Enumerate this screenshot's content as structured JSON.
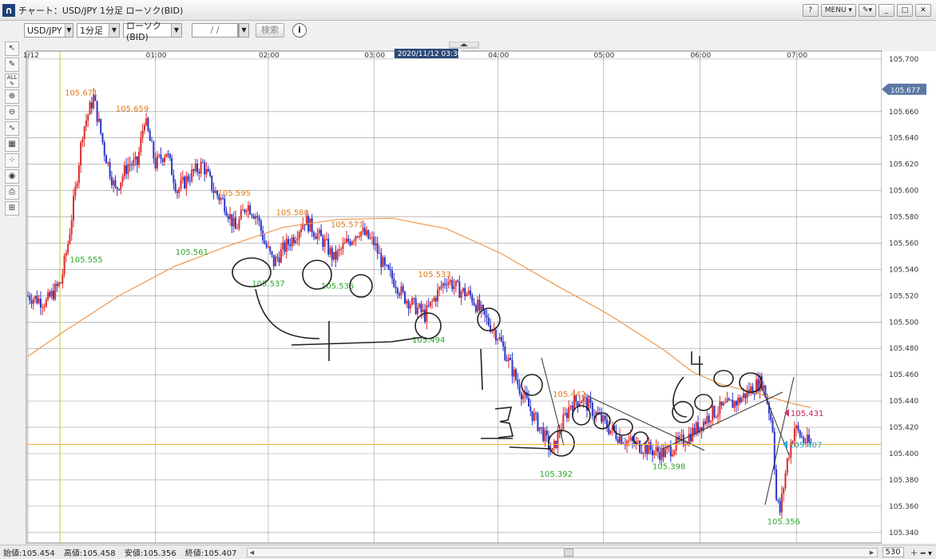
{
  "window": {
    "title": "チャート：USD/JPY 1分足 ローソク(BID)",
    "buttons": [
      "?",
      "MENU ▾",
      "✎▾",
      "_",
      "□",
      "✕"
    ]
  },
  "toolbar": {
    "pair": "USD/JPY",
    "timeframe": "1分足",
    "chart_type": "ローソク(BID)",
    "date_placeholder": "/ /",
    "search_label": "検索",
    "info_label": "i"
  },
  "tools": [
    "cursor-tool",
    "pen-tool",
    "all-tool",
    "zoom-in-tool",
    "zoom-out-tool",
    "indicator-tool",
    "table-tool",
    "dots-tool",
    "view-tool",
    "print-tool",
    "grid-tool"
  ],
  "statusbar": {
    "open": "始値:105.454",
    "high": "高値:105.458",
    "low": "安値:105.356",
    "close": "終値:105.407",
    "bar_count": "530"
  },
  "colors": {
    "up": "#dd2a2a",
    "down": "#2b34c9",
    "ma": "#f0964a",
    "current_line": "#f3b23f",
    "high_label": "#e07a1a",
    "low_label": "#2aa52a",
    "price_box": "#5a78a3"
  },
  "chart_data": {
    "type": "candlestick",
    "symbol": "USD/JPY",
    "time_labels": [
      "11/12",
      "01:00",
      "02:00",
      "03:00",
      "04:00",
      "05:00",
      "06:00",
      "07:00"
    ],
    "cursor_label": "2020/11/12 03:30",
    "y_ticks": [
      "105.700",
      "105.660",
      "105.640",
      "105.620",
      "105.600",
      "105.580",
      "105.560",
      "105.540",
      "105.520",
      "105.500",
      "105.480",
      "105.460",
      "105.440",
      "105.420",
      "105.400",
      "105.380",
      "105.360",
      "105.340"
    ],
    "ylim": [
      105.332,
      105.706
    ],
    "price_path": [
      [
        0,
        105.52
      ],
      [
        10,
        105.515
      ],
      [
        18,
        105.53
      ],
      [
        22,
        105.56
      ],
      [
        26,
        105.6
      ],
      [
        30,
        105.645
      ],
      [
        36,
        105.671
      ],
      [
        42,
        105.63
      ],
      [
        48,
        105.6
      ],
      [
        55,
        105.62
      ],
      [
        60,
        105.62
      ],
      [
        64,
        105.655
      ],
      [
        70,
        105.62
      ],
      [
        76,
        105.63
      ],
      [
        82,
        105.6
      ],
      [
        88,
        105.61
      ],
      [
        96,
        105.62
      ],
      [
        102,
        105.6
      ],
      [
        108,
        105.59
      ],
      [
        114,
        105.57
      ],
      [
        120,
        105.59
      ],
      [
        126,
        105.58
      ],
      [
        130,
        105.56
      ],
      [
        135,
        105.545
      ],
      [
        140,
        105.555
      ],
      [
        146,
        105.565
      ],
      [
        152,
        105.578
      ],
      [
        158,
        105.568
      ],
      [
        163,
        105.56
      ],
      [
        168,
        105.548
      ],
      [
        175,
        105.56
      ],
      [
        182,
        105.57
      ],
      [
        190,
        105.56
      ],
      [
        196,
        105.54
      ],
      [
        202,
        105.53
      ],
      [
        206,
        105.52
      ],
      [
        210,
        105.515
      ],
      [
        214,
        105.51
      ],
      [
        218,
        105.505
      ],
      [
        224,
        105.52
      ],
      [
        230,
        105.533
      ],
      [
        236,
        105.525
      ],
      [
        243,
        105.52
      ],
      [
        250,
        105.505
      ],
      [
        258,
        105.49
      ],
      [
        264,
        105.47
      ],
      [
        270,
        105.45
      ],
      [
        277,
        105.43
      ],
      [
        283,
        105.415
      ],
      [
        288,
        105.4
      ],
      [
        292,
        105.418
      ],
      [
        298,
        105.438
      ],
      [
        304,
        105.442
      ],
      [
        312,
        105.43
      ],
      [
        320,
        105.418
      ],
      [
        328,
        105.41
      ],
      [
        336,
        105.406
      ],
      [
        344,
        105.402
      ],
      [
        350,
        105.4
      ],
      [
        354,
        105.405
      ],
      [
        360,
        105.41
      ],
      [
        368,
        105.42
      ],
      [
        375,
        105.43
      ],
      [
        382,
        105.435
      ],
      [
        390,
        105.44
      ],
      [
        398,
        105.45
      ],
      [
        403,
        105.455
      ],
      [
        406,
        105.44
      ],
      [
        409,
        105.42
      ],
      [
        411,
        105.365
      ],
      [
        413,
        105.356
      ],
      [
        417,
        105.395
      ],
      [
        421,
        105.42
      ],
      [
        426,
        105.41
      ],
      [
        430,
        105.407
      ]
    ],
    "moving_average": [
      [
        0,
        105.474
      ],
      [
        20,
        105.493
      ],
      [
        50,
        105.52
      ],
      [
        80,
        105.542
      ],
      [
        110,
        105.558
      ],
      [
        140,
        105.572
      ],
      [
        170,
        105.578
      ],
      [
        200,
        105.579
      ],
      [
        230,
        105.571
      ],
      [
        260,
        105.552
      ],
      [
        290,
        105.528
      ],
      [
        320,
        105.505
      ],
      [
        350,
        105.478
      ],
      [
        365,
        105.462
      ],
      [
        380,
        105.453
      ],
      [
        400,
        105.446
      ],
      [
        420,
        105.438
      ],
      [
        430,
        105.435
      ]
    ],
    "annotations_high": [
      {
        "t": 36,
        "v": 105.671,
        "label": "105.671"
      },
      {
        "t": 64,
        "v": 105.659,
        "label": "105.659"
      },
      {
        "t": 120,
        "v": 105.595,
        "label": "105.595"
      },
      {
        "t": 152,
        "v": 105.58,
        "label": "105.580"
      },
      {
        "t": 182,
        "v": 105.571,
        "label": "105.571"
      },
      {
        "t": 230,
        "v": 105.533,
        "label": "105.533"
      },
      {
        "t": 304,
        "v": 105.442,
        "label": "105.442"
      }
    ],
    "annotations_low": [
      {
        "t": 30,
        "v": 105.555,
        "label": "105.555"
      },
      {
        "t": 88,
        "v": 105.561,
        "label": "105.561"
      },
      {
        "t": 130,
        "v": 105.537,
        "label": "105.537"
      },
      {
        "t": 168,
        "v": 105.535,
        "label": "105.535"
      },
      {
        "t": 218,
        "v": 105.494,
        "label": "105.494"
      },
      {
        "t": 288,
        "v": 105.392,
        "label": "105.392"
      },
      {
        "t": 350,
        "v": 105.398,
        "label": "105.398"
      },
      {
        "t": 413,
        "v": 105.356,
        "label": "105.356"
      }
    ],
    "current_price": "105.407",
    "ask_price": "105.431",
    "top_price": "105.677",
    "handwritten_text": [
      "4",
      "3",
      "4"
    ]
  }
}
